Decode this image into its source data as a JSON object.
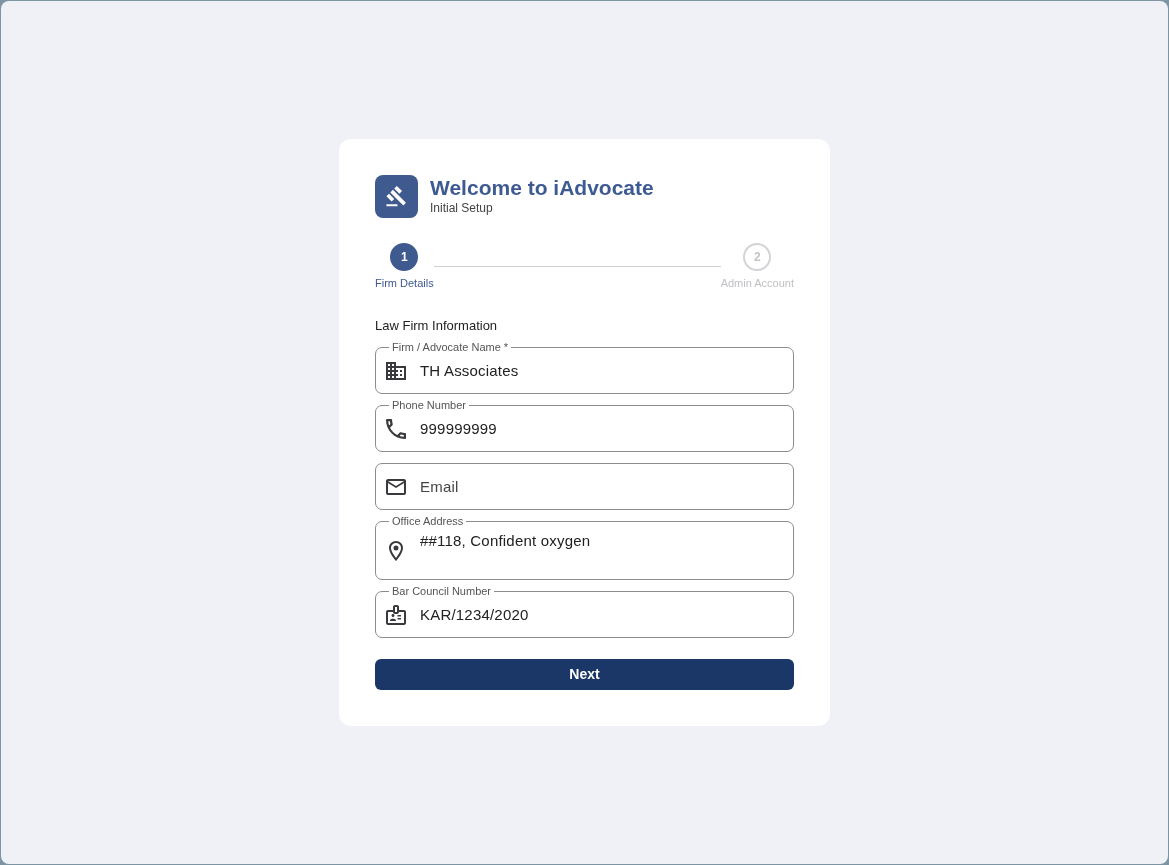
{
  "header": {
    "title": "Welcome to iAdvocate",
    "subtitle": "Initial Setup"
  },
  "steps": [
    {
      "number": "1",
      "label": "Firm Details",
      "selected": true
    },
    {
      "number": "2",
      "label": "Admin Account",
      "selected": false
    }
  ],
  "section_title": "Law Firm Information",
  "fields": [
    {
      "kind": "text",
      "label": "Firm / Advocate Name *",
      "value": "TH Associates"
    },
    {
      "kind": "text",
      "label": "Phone Number",
      "value": "999999999"
    },
    {
      "kind": "text",
      "placeholder": "Email"
    },
    {
      "kind": "textarea",
      "label": "Office Address",
      "value": "##118, Confident oxygen"
    },
    {
      "kind": "text",
      "label": "Bar Council Number",
      "value": "KAR/1234/2020"
    }
  ],
  "next_button": {
    "label": "Next"
  }
}
